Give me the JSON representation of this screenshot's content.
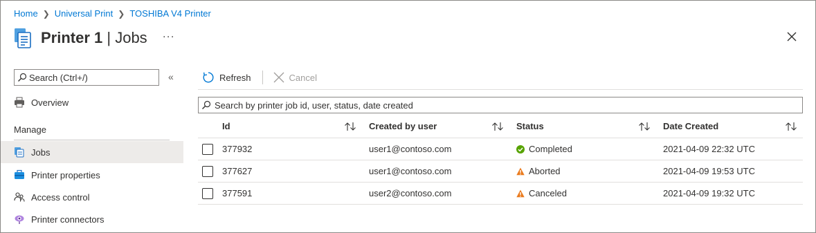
{
  "breadcrumb": {
    "items": [
      "Home",
      "Universal Print",
      "TOSHIBA V4 Printer"
    ]
  },
  "header": {
    "title_bold": "Printer 1",
    "title_rest": " | Jobs",
    "more": "···",
    "icon": "printer-jobs-icon"
  },
  "sidebar": {
    "search_placeholder": "Search (Ctrl+/)",
    "collapse": "«",
    "items": [
      {
        "label": "Overview",
        "icon": "printer-icon"
      },
      {
        "label": "Jobs",
        "icon": "jobs-icon",
        "active": true
      },
      {
        "label": "Printer properties",
        "icon": "briefcase-icon"
      },
      {
        "label": "Access control",
        "icon": "people-icon"
      },
      {
        "label": "Printer connectors",
        "icon": "connector-icon"
      }
    ],
    "section_manage": "Manage"
  },
  "toolbar": {
    "refresh_label": "Refresh",
    "cancel_label": "Cancel"
  },
  "filter": {
    "placeholder": "Search by printer job id, user, status, date created"
  },
  "table": {
    "columns": [
      "Id",
      "Created by user",
      "Status",
      "Date Created"
    ],
    "rows": [
      {
        "id": "377932",
        "user": "user1@contoso.com",
        "status": "Completed",
        "status_kind": "success",
        "date": "2021-04-09 22:32 UTC"
      },
      {
        "id": "377627",
        "user": "user1@contoso.com",
        "status": "Aborted",
        "status_kind": "warning",
        "date": "2021-04-09 19:53 UTC"
      },
      {
        "id": "377591",
        "user": "user2@contoso.com",
        "status": "Canceled",
        "status_kind": "warning",
        "date": "2021-04-09 19:32 UTC"
      }
    ]
  },
  "colors": {
    "link": "#0078d4",
    "success": "#57a300",
    "warning": "#ea7b1e",
    "active_bg": "#edebe9"
  }
}
